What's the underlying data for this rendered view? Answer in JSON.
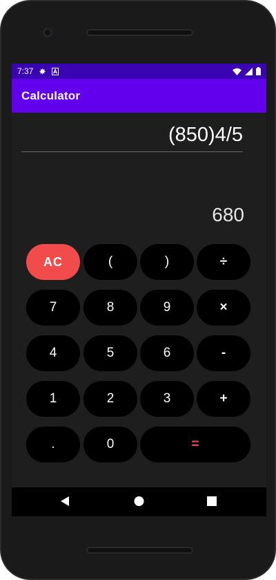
{
  "status_bar": {
    "time": "7:37",
    "icons": [
      "gear-icon",
      "a-badge-icon",
      "wifi-icon",
      "signal-icon",
      "battery-icon"
    ]
  },
  "app_bar": {
    "title": "Calculator"
  },
  "display": {
    "expression": "(850)4/5",
    "result": "680"
  },
  "keypad": {
    "rows": [
      [
        "AC",
        "(",
        ")",
        "÷"
      ],
      [
        "7",
        "8",
        "9",
        "×"
      ],
      [
        "4",
        "5",
        "6",
        "-"
      ],
      [
        "1",
        "2",
        "3",
        "+"
      ],
      [
        ".",
        "0",
        "="
      ]
    ]
  },
  "nav_bar": {
    "icons": [
      "back-icon",
      "home-icon",
      "recents-icon"
    ]
  },
  "colors": {
    "status_bar": "#3a04b2",
    "app_bar": "#6200ee",
    "accent_red": "#f24b4b",
    "screen_bg": "#1e1e1e",
    "key_bg": "#000000"
  }
}
